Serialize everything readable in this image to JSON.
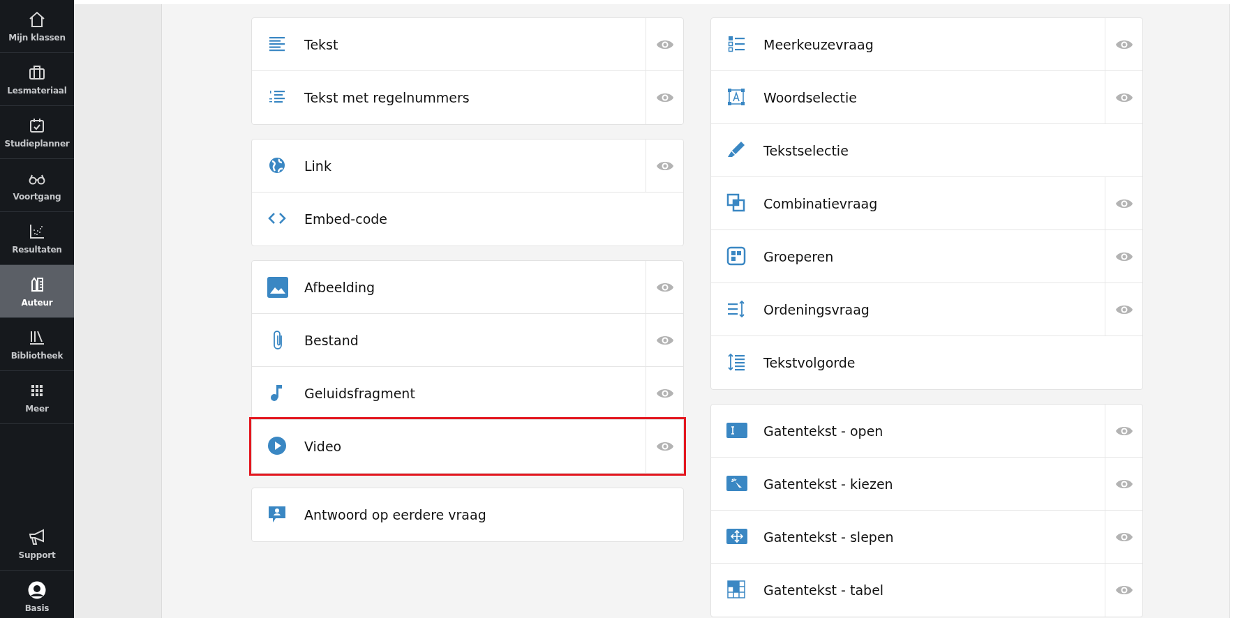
{
  "sidebar": {
    "items": [
      {
        "label": "Mijn klassen",
        "selected": false
      },
      {
        "label": "Lesmateriaal",
        "selected": false
      },
      {
        "label": "Studieplanner",
        "selected": false
      },
      {
        "label": "Voortgang",
        "selected": false
      },
      {
        "label": "Resultaten",
        "selected": false
      },
      {
        "label": "Auteur",
        "selected": true
      },
      {
        "label": "Bibliotheek",
        "selected": false
      },
      {
        "label": "Meer",
        "selected": false
      }
    ],
    "bottom_items": [
      {
        "label": "Support",
        "selected": false
      },
      {
        "label": "Basis",
        "selected": false
      }
    ]
  },
  "columns": [
    {
      "cards": [
        {
          "rows": [
            {
              "label": "Tekst",
              "preview": true,
              "highlighted": false
            },
            {
              "label": "Tekst met regelnummers",
              "preview": true,
              "highlighted": false
            }
          ]
        },
        {
          "rows": [
            {
              "label": "Link",
              "preview": true,
              "highlighted": false
            },
            {
              "label": "Embed-code",
              "preview": false,
              "highlighted": false
            }
          ]
        },
        {
          "rows": [
            {
              "label": "Afbeelding",
              "preview": true,
              "highlighted": false
            },
            {
              "label": "Bestand",
              "preview": true,
              "highlighted": false
            },
            {
              "label": "Geluidsfragment",
              "preview": true,
              "highlighted": false
            },
            {
              "label": "Video",
              "preview": true,
              "highlighted": true
            }
          ]
        },
        {
          "rows": [
            {
              "label": "Antwoord op eerdere vraag",
              "preview": false,
              "highlighted": false
            }
          ]
        }
      ]
    },
    {
      "cards": [
        {
          "rows": [
            {
              "label": "Meerkeuzevraag",
              "preview": true,
              "highlighted": false
            },
            {
              "label": "Woordselectie",
              "preview": true,
              "highlighted": false
            },
            {
              "label": "Tekstselectie",
              "preview": false,
              "highlighted": false
            },
            {
              "label": "Combinatievraag",
              "preview": true,
              "highlighted": false
            },
            {
              "label": "Groeperen",
              "preview": true,
              "highlighted": false
            },
            {
              "label": "Ordeningsvraag",
              "preview": true,
              "highlighted": false
            },
            {
              "label": "Tekstvolgorde",
              "preview": false,
              "highlighted": false
            }
          ]
        },
        {
          "rows": [
            {
              "label": "Gatentekst - open",
              "preview": true,
              "highlighted": false
            },
            {
              "label": "Gatentekst - kiezen",
              "preview": true,
              "highlighted": false
            },
            {
              "label": "Gatentekst - slepen",
              "preview": true,
              "highlighted": false
            },
            {
              "label": "Gatentekst - tabel",
              "preview": true,
              "highlighted": false
            }
          ]
        }
      ]
    }
  ]
}
